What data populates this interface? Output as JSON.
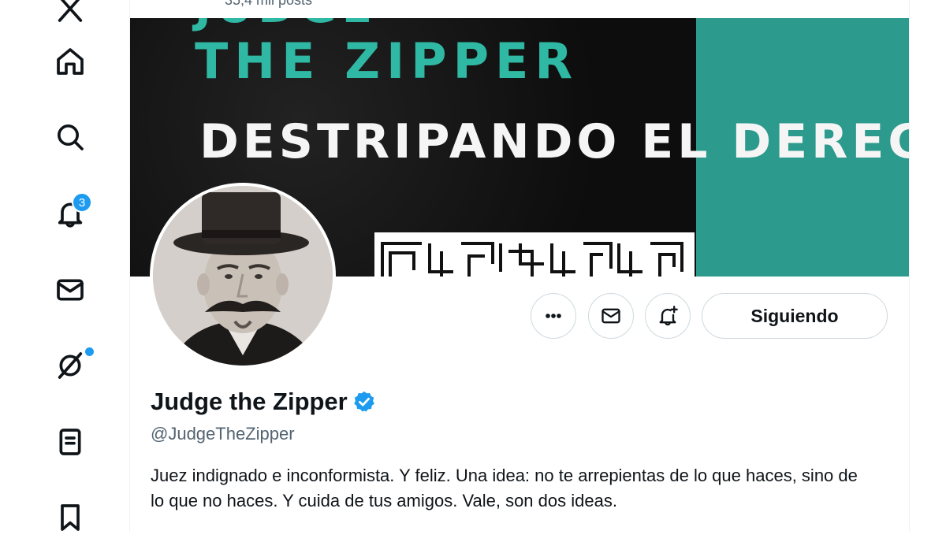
{
  "header": {
    "post_count": "35,4 mil posts"
  },
  "nav": {
    "items": [
      {
        "icon": "home-icon"
      },
      {
        "icon": "search-icon"
      },
      {
        "icon": "bell-icon",
        "badge": "3"
      },
      {
        "icon": "mail-icon"
      },
      {
        "icon": "grok-icon",
        "dot": true
      },
      {
        "icon": "list-icon"
      },
      {
        "icon": "bookmark-icon"
      }
    ]
  },
  "banner": {
    "cut_text": "JUDGE",
    "title": "THE ZIPPER",
    "subtitle": "DESTRIPANDO EL DERECHO",
    "colors": {
      "dark": "#111111",
      "teal": "#2c9a8c",
      "title": "#2fb8a3"
    }
  },
  "profile": {
    "name": "Judge the Zipper",
    "verified": true,
    "handle": "@JudgeTheZipper",
    "bio": "Juez indignado e inconformista. Y feliz. Una idea: no te arrepientas de lo que haces, sino de lo que no haces. Y cuida de tus amigos. Vale, son dos ideas.",
    "follow_label": "Siguiendo"
  },
  "colors": {
    "accent": "#1d9bf0",
    "text": "#0f1419",
    "secondary": "#536471",
    "border": "#cfd9de"
  }
}
